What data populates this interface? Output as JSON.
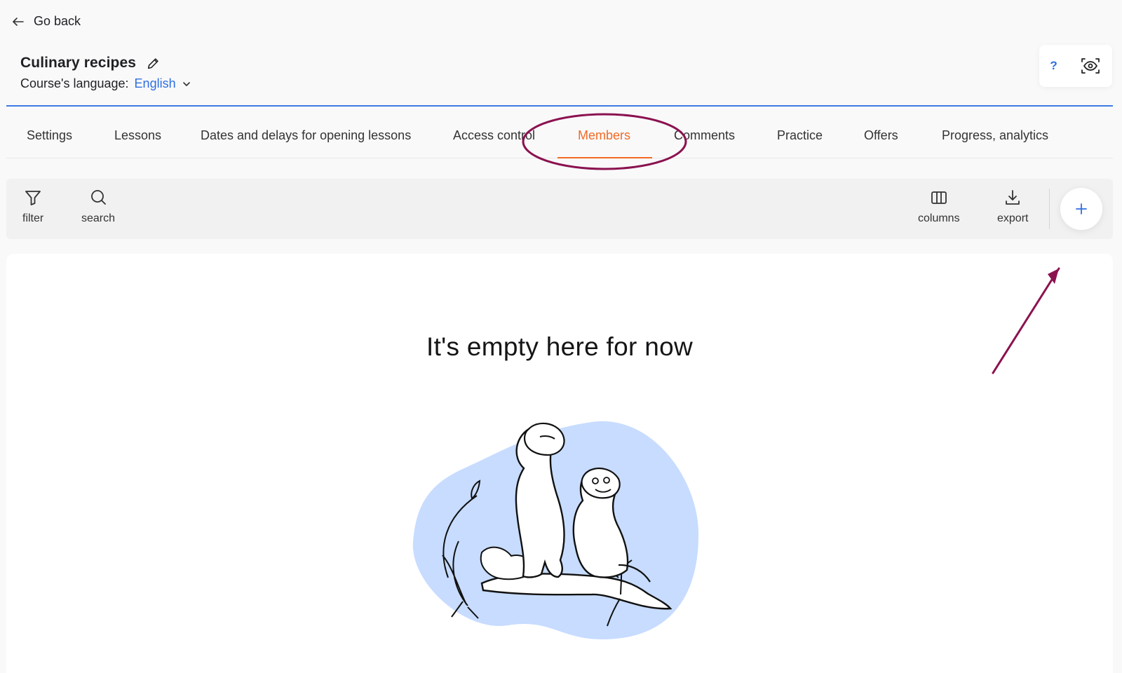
{
  "header": {
    "go_back_label": "Go back",
    "course_title": "Culinary recipes",
    "language_label": "Course's language:",
    "language_value": "English"
  },
  "tabs": [
    {
      "label": "Settings",
      "active": false
    },
    {
      "label": "Lessons",
      "active": false
    },
    {
      "label": "Dates and delays for opening lessons",
      "active": false
    },
    {
      "label": "Access control",
      "active": false
    },
    {
      "label": "Members",
      "active": true
    },
    {
      "label": "Comments",
      "active": false
    },
    {
      "label": "Practice",
      "active": false
    },
    {
      "label": "Offers",
      "active": false
    },
    {
      "label": "Progress, analytics",
      "active": false
    }
  ],
  "toolbar": {
    "filter_label": "filter",
    "search_label": "search",
    "columns_label": "columns",
    "export_label": "export"
  },
  "top_tools": {
    "help_label": "?"
  },
  "empty_state": {
    "title": "It's empty here for now"
  },
  "icons": {
    "go_back": "arrow-left-icon",
    "edit": "pencil-icon",
    "language_dropdown": "chevron-down-icon",
    "help": "question-icon",
    "preview": "eye-icon",
    "filter": "filter-icon",
    "search": "search-icon",
    "columns": "columns-icon",
    "export": "download-icon",
    "add": "plus-icon"
  },
  "colors": {
    "accent_blue": "#2f6fe0",
    "active_tab": "#f26a25",
    "annotation": "#8b124f",
    "illustration_blob": "#c7dcff"
  }
}
